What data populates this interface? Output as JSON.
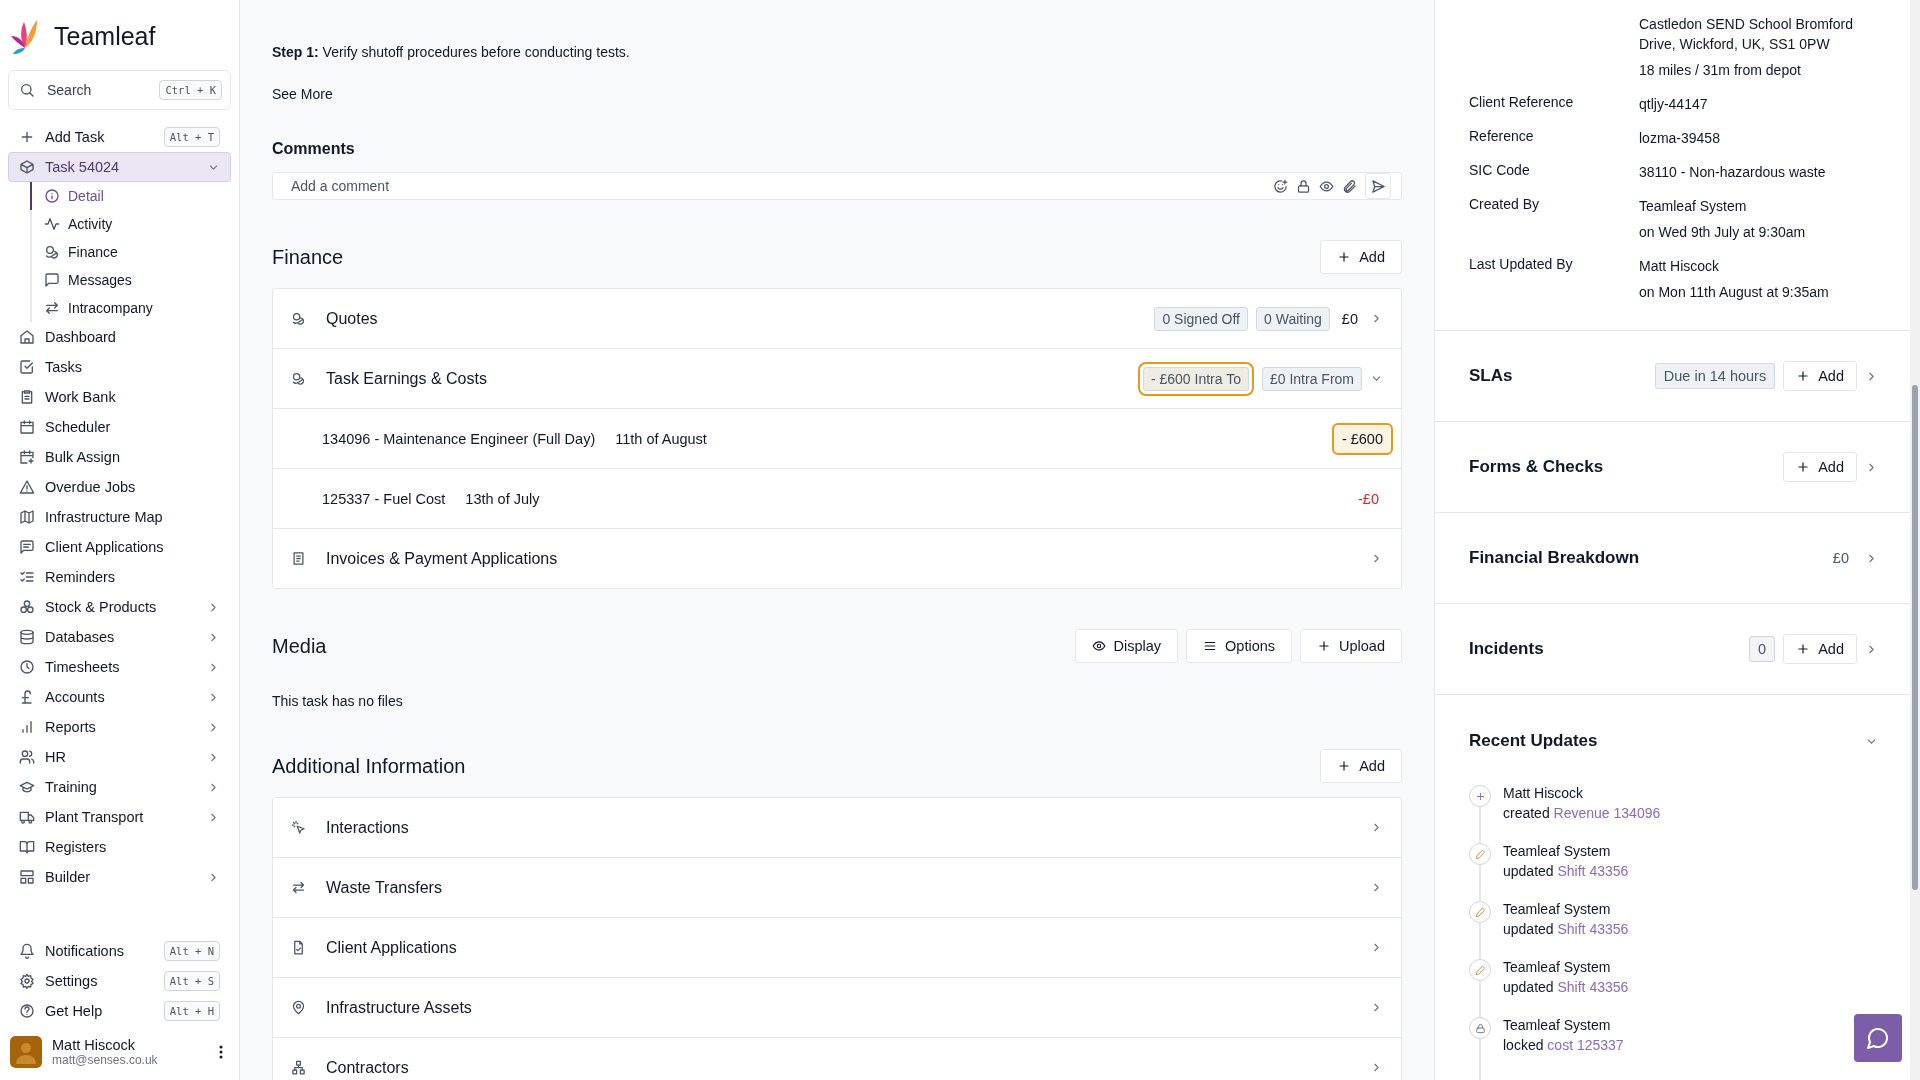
{
  "brand": {
    "name": "Teamleaf"
  },
  "search": {
    "placeholder": "Search",
    "shortcut": "Ctrl + K"
  },
  "add_task": {
    "label": "Add Task",
    "shortcut": "Alt + T"
  },
  "task": {
    "label": "Task 54024",
    "selected": true,
    "expanded": true,
    "children": [
      {
        "label": "Detail",
        "selected": true
      },
      {
        "label": "Activity",
        "selected": false
      },
      {
        "label": "Finance",
        "selected": false
      },
      {
        "label": "Messages",
        "selected": false
      },
      {
        "label": "Intracompany",
        "selected": false
      }
    ]
  },
  "nav": [
    {
      "label": "Dashboard",
      "has_submenu": false
    },
    {
      "label": "Tasks",
      "has_submenu": false
    },
    {
      "label": "Work Bank",
      "has_submenu": false
    },
    {
      "label": "Scheduler",
      "has_submenu": false
    },
    {
      "label": "Bulk Assign",
      "has_submenu": false
    },
    {
      "label": "Overdue Jobs",
      "has_submenu": false
    },
    {
      "label": "Infrastructure Map",
      "has_submenu": false
    },
    {
      "label": "Client Applications",
      "has_submenu": false
    },
    {
      "label": "Reminders",
      "has_submenu": false
    },
    {
      "label": "Stock & Products",
      "has_submenu": true
    },
    {
      "label": "Databases",
      "has_submenu": true
    },
    {
      "label": "Timesheets",
      "has_submenu": true
    },
    {
      "label": "Accounts",
      "has_submenu": true
    },
    {
      "label": "Reports",
      "has_submenu": true
    },
    {
      "label": "HR",
      "has_submenu": true
    },
    {
      "label": "Training",
      "has_submenu": true
    },
    {
      "label": "Plant Transport",
      "has_submenu": true
    },
    {
      "label": "Registers",
      "has_submenu": false
    },
    {
      "label": "Builder",
      "has_submenu": true
    }
  ],
  "nav_bottom": [
    {
      "label": "Notifications",
      "shortcut": "Alt + N"
    },
    {
      "label": "Settings",
      "shortcut": "Alt + S"
    },
    {
      "label": "Get Help",
      "shortcut": "Alt + H"
    }
  ],
  "user": {
    "name": "Matt Hiscock",
    "email": "matt@senses.co.uk"
  },
  "step": "**Step 1:** Verify shutoff procedures before conducting tests.",
  "see_more": "See More",
  "comments": {
    "title": "Comments",
    "placeholder": "Add a comment"
  },
  "finance": {
    "title": "Finance",
    "add": "Add",
    "rows": [
      {
        "kind": "group",
        "title": "Quotes",
        "badges": [
          {
            "label": "0 Signed Off",
            "highlighted": false
          },
          {
            "label": "0 Waiting",
            "highlighted": false
          }
        ],
        "amount": "£0",
        "expanded": false
      },
      {
        "kind": "group",
        "title": "Task Earnings & Costs",
        "badges": [
          {
            "label": "- £600 Intra To",
            "highlighted": true
          },
          {
            "label": "£0 Intra From",
            "highlighted": false
          }
        ],
        "expanded": true
      },
      {
        "kind": "line",
        "title": "134096 - Maintenance Engineer (Full Day)",
        "date": "11th of August",
        "amount": "- £600",
        "highlighted": true,
        "negative": false
      },
      {
        "kind": "line",
        "title": "125337 - Fuel Cost",
        "date": "13th of July",
        "amount": "-£0",
        "highlighted": false,
        "negative": true
      },
      {
        "kind": "group",
        "title": "Invoices & Payment Applications",
        "expanded": false
      }
    ]
  },
  "media": {
    "title": "Media",
    "buttons": [
      "Display",
      "Options",
      "Upload"
    ],
    "empty": "This task has no files"
  },
  "additional": {
    "title": "Additional Information",
    "add": "Add",
    "rows": [
      "Interactions",
      "Waste Transfers",
      "Client Applications",
      "Infrastructure Assets",
      "Contractors"
    ]
  },
  "details": [
    {
      "lines": [
        "Castledon SEND School Bromford Drive, Wickford, UK, SS1 0PW",
        "18 miles / 31m from depot"
      ]
    },
    {
      "label": "Client Reference",
      "lines": [
        "qtljy-44147"
      ]
    },
    {
      "label": "Reference",
      "lines": [
        "lozma-39458"
      ]
    },
    {
      "label": "SIC Code",
      "lines": [
        "38110 - Non-hazardous waste"
      ]
    },
    {
      "label": "Created By",
      "lines": [
        "Teamleaf System",
        "on Wed 9th July at 9:30am"
      ]
    },
    {
      "label": "Last Updated By",
      "lines": [
        "Matt Hiscock",
        "on Mon 11th August at 9:35am"
      ]
    }
  ],
  "panels": [
    {
      "title": "SLAs",
      "badge": "Due in 14 hours",
      "add": "Add",
      "expanded": false
    },
    {
      "title": "Forms & Checks",
      "add": "Add",
      "expanded": false
    },
    {
      "title": "Financial Breakdown",
      "amount": "£0",
      "expanded": false
    },
    {
      "title": "Incidents",
      "count": "0",
      "add": "Add",
      "expanded": false
    }
  ],
  "recent_updates": {
    "title": "Recent Updates",
    "expanded": true,
    "items": [
      {
        "kind": "create",
        "actor": "Matt Hiscock",
        "action": "created",
        "link": "Revenue 134096"
      },
      {
        "kind": "update",
        "actor": "Teamleaf System",
        "action": "updated",
        "link": "Shift 43356"
      },
      {
        "kind": "update",
        "actor": "Teamleaf System",
        "action": "updated",
        "link": "Shift 43356"
      },
      {
        "kind": "update",
        "actor": "Teamleaf System",
        "action": "updated",
        "link": "Shift 43356"
      },
      {
        "kind": "lock",
        "actor": "Teamleaf System",
        "action": "locked",
        "link": "cost 125337"
      }
    ]
  }
}
